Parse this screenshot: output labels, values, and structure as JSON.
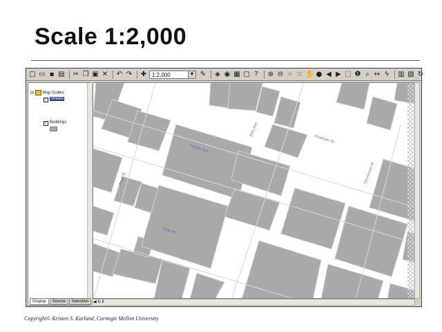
{
  "slide": {
    "title": "Scale 1:2,000",
    "copyright": "Copyright© Kristen S. Kurland, Carnegie Mellon University"
  },
  "toolbar": {
    "scale_value": "1:2,000",
    "icons_left": [
      "new-icon",
      "open-icon",
      "save-icon",
      "print-icon",
      "cut-icon",
      "copy-icon",
      "paste-icon",
      "delete-icon",
      "undo-icon",
      "redo-icon",
      "add-data-icon"
    ],
    "icons_right": [
      "editor-icon",
      "arcmap-icon",
      "arccatalog-icon",
      "toolbox-icon",
      "command-icon",
      "help-icon",
      "zoom-in-icon",
      "zoom-out-icon",
      "fixed-zoom-in-icon",
      "fixed-zoom-out-icon",
      "pan-icon",
      "full-extent-icon",
      "back-icon",
      "forward-icon",
      "select-icon",
      "identify-icon",
      "find-icon",
      "measure-icon",
      "hyperlink-icon",
      "layout-icon",
      "data-icon",
      "refresh-icon",
      "pause-icon"
    ]
  },
  "toc": {
    "root_label": "Map Scales",
    "layer1_label": "Streets",
    "layer2_label": "Buildings",
    "tabs": [
      "Display",
      "Source",
      "Selection"
    ]
  },
  "map": {
    "background": "#ffffff",
    "building_color": "#a9a9a9",
    "street_labels": [
      "Forbes Ave",
      "Fifth Ave",
      "Stevenson St",
      "Boyd St",
      "Chatham St",
      "Pride St"
    ]
  },
  "colors": {
    "rule": "#b03a3a",
    "chrome": "#d4d0c8"
  }
}
